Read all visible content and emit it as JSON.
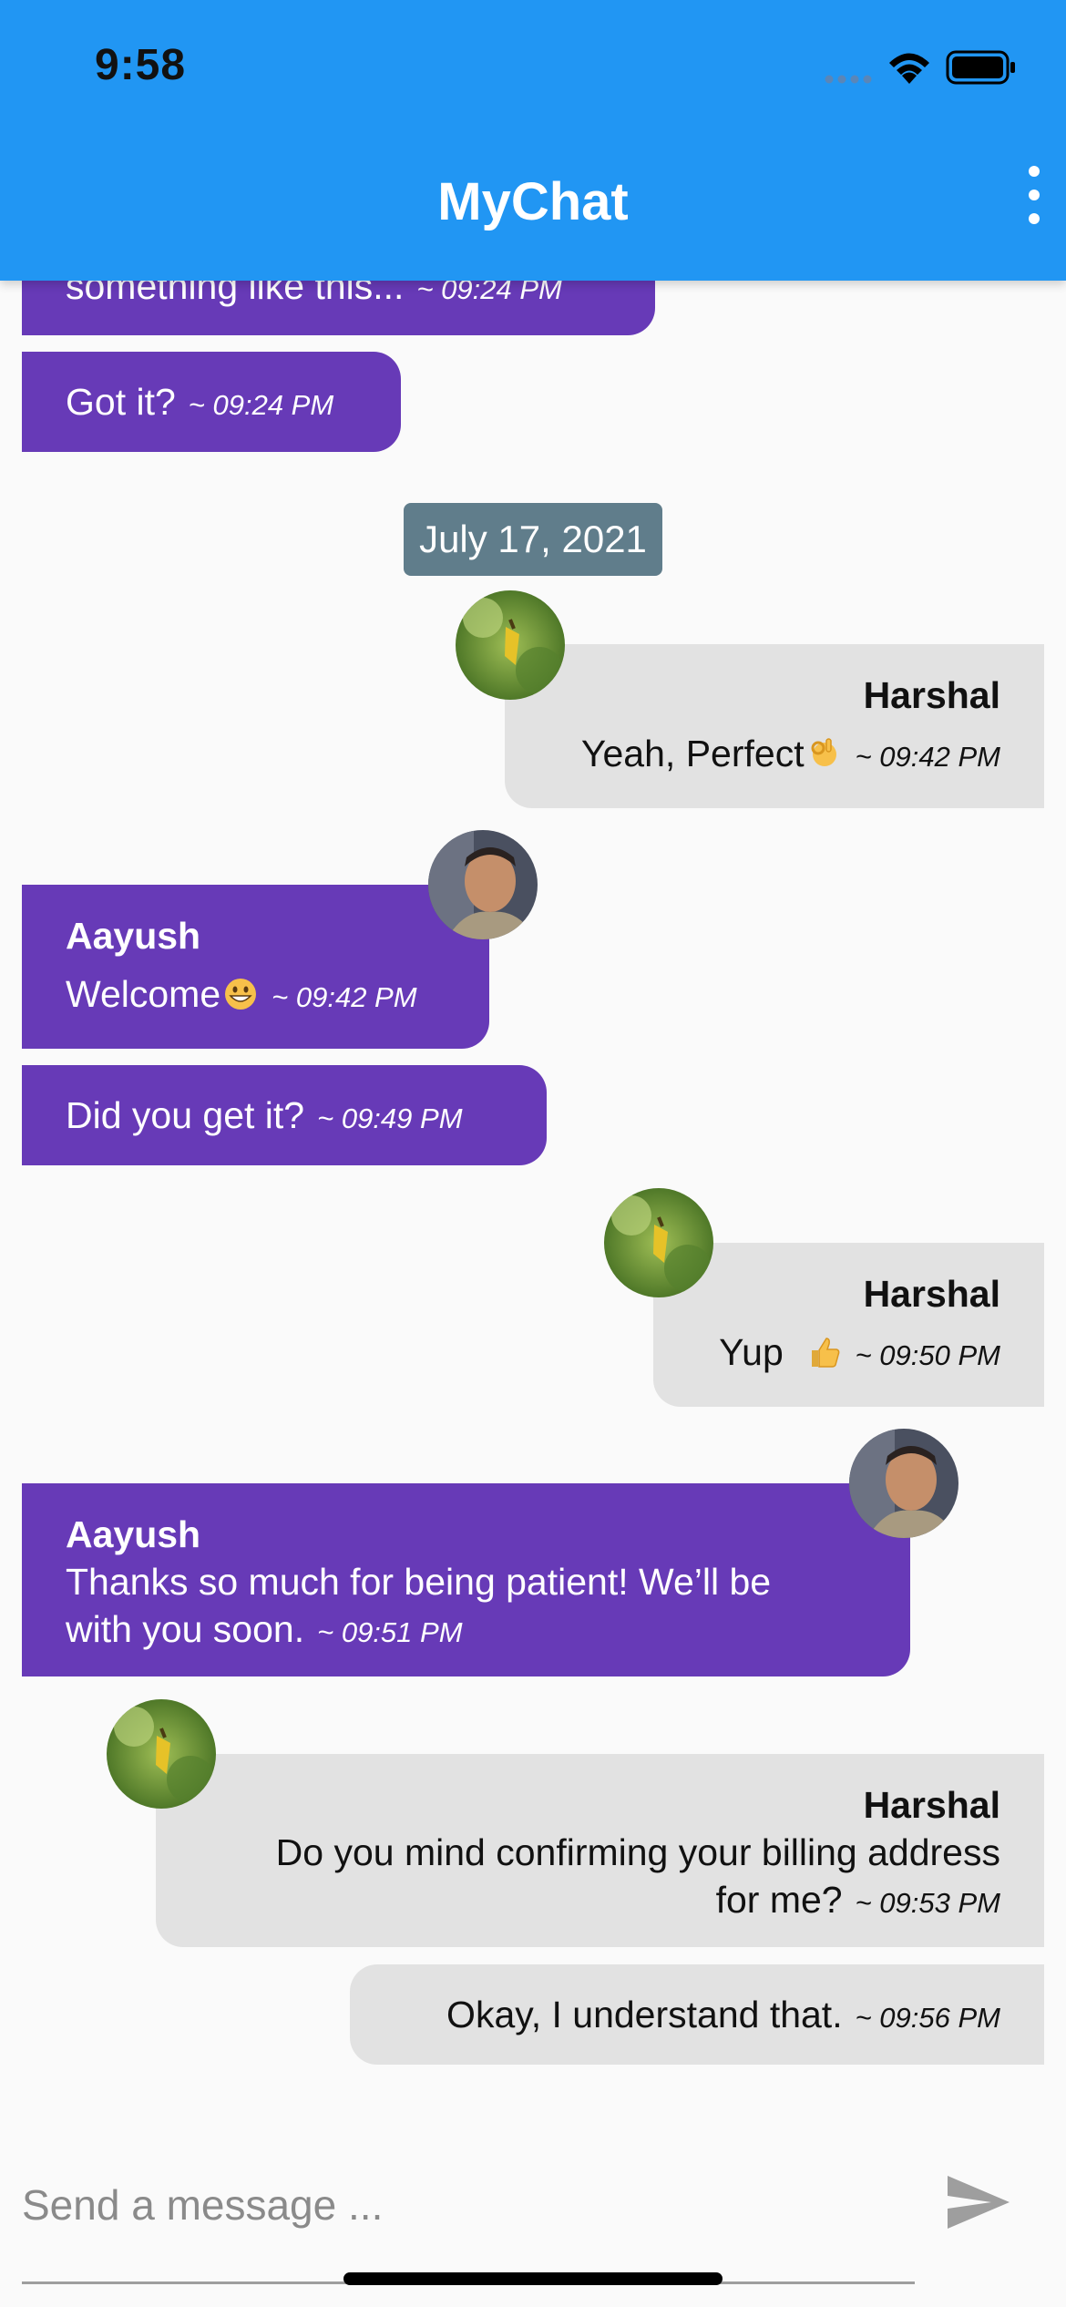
{
  "status_bar": {
    "time": "9:58"
  },
  "app_bar": {
    "title": "MyChat"
  },
  "messages": [
    {
      "side": "in",
      "text": "something like this...",
      "time": "~ 09:24 PM"
    },
    {
      "side": "in",
      "text": "Got it?",
      "time": "~ 09:24 PM"
    },
    {
      "side": "out",
      "sender": "Harshal",
      "text": "Yeah, Perfect",
      "emoji": "ok-hand-emoji",
      "time": "~ 09:42 PM"
    },
    {
      "side": "in",
      "sender": "Aayush",
      "text": "Welcome",
      "emoji": "grinning-face-emoji",
      "time": "~ 09:42 PM"
    },
    {
      "side": "in",
      "text": "Did you get it?",
      "time": "~ 09:49 PM"
    },
    {
      "side": "out",
      "sender": "Harshal",
      "text": "Yup",
      "emoji": "thumbs-up-emoji",
      "time": "~ 09:50 PM"
    },
    {
      "side": "in",
      "sender": "Aayush",
      "text_line1": "Thanks so much for being patient! We’ll be",
      "text_line2": "with you soon.",
      "time": "~ 09:51 PM"
    },
    {
      "side": "out",
      "sender": "Harshal",
      "text_line1": "Do you mind confirming your billing address",
      "text_line2": "for me?",
      "time": "~ 09:53 PM"
    },
    {
      "side": "out",
      "text": "Okay, I understand that.",
      "time": "~ 09:56 PM"
    }
  ],
  "date_separator": "July 17, 2021",
  "input": {
    "placeholder": "Send a message ...",
    "value": ""
  },
  "colors": {
    "app_bar": "#2196f3",
    "incoming_bubble": "#673ab7",
    "outgoing_bubble": "#e2e2e2",
    "date_chip": "#607d8b",
    "background": "#fafafa"
  },
  "icons": [
    "signal-icon",
    "wifi-icon",
    "battery-icon",
    "more-vert-icon",
    "send-icon"
  ]
}
